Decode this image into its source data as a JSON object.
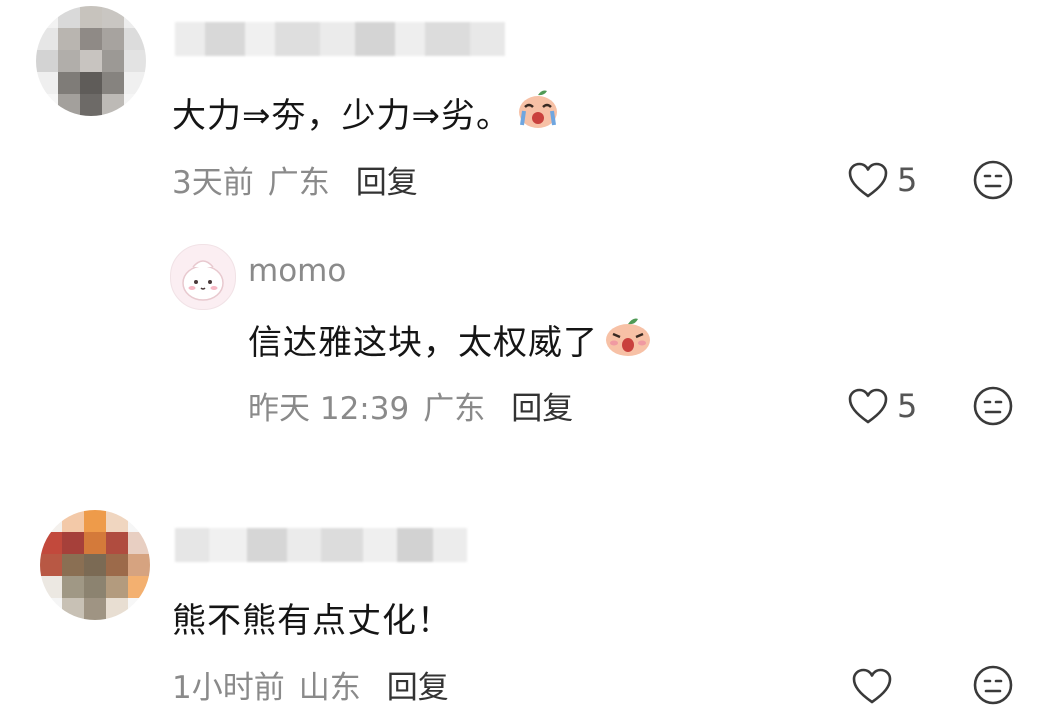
{
  "comments": [
    {
      "text": "大力⇒夯，少力⇒劣。",
      "time": "3天前",
      "location": "广东",
      "reply_label": "回复",
      "likes": "5",
      "emoji": "crying-laughing-peach-emoji"
    },
    {
      "username": "momo",
      "text": "信达雅这块，太权威了",
      "time": "昨天 12:39",
      "location": "广东",
      "reply_label": "回复",
      "likes": "5",
      "emoji": "shocked-peach-emoji"
    },
    {
      "text": "熊不熊有点丈化！",
      "time": "1小时前",
      "location": "山东",
      "reply_label": "回复",
      "likes": ""
    }
  ],
  "icons": {
    "like": "heart-outline-icon",
    "dislike": "neutral-face-icon"
  },
  "colors": {
    "text": "#151515",
    "meta": "#8a8a8a",
    "icon": "#3a3a3a"
  }
}
